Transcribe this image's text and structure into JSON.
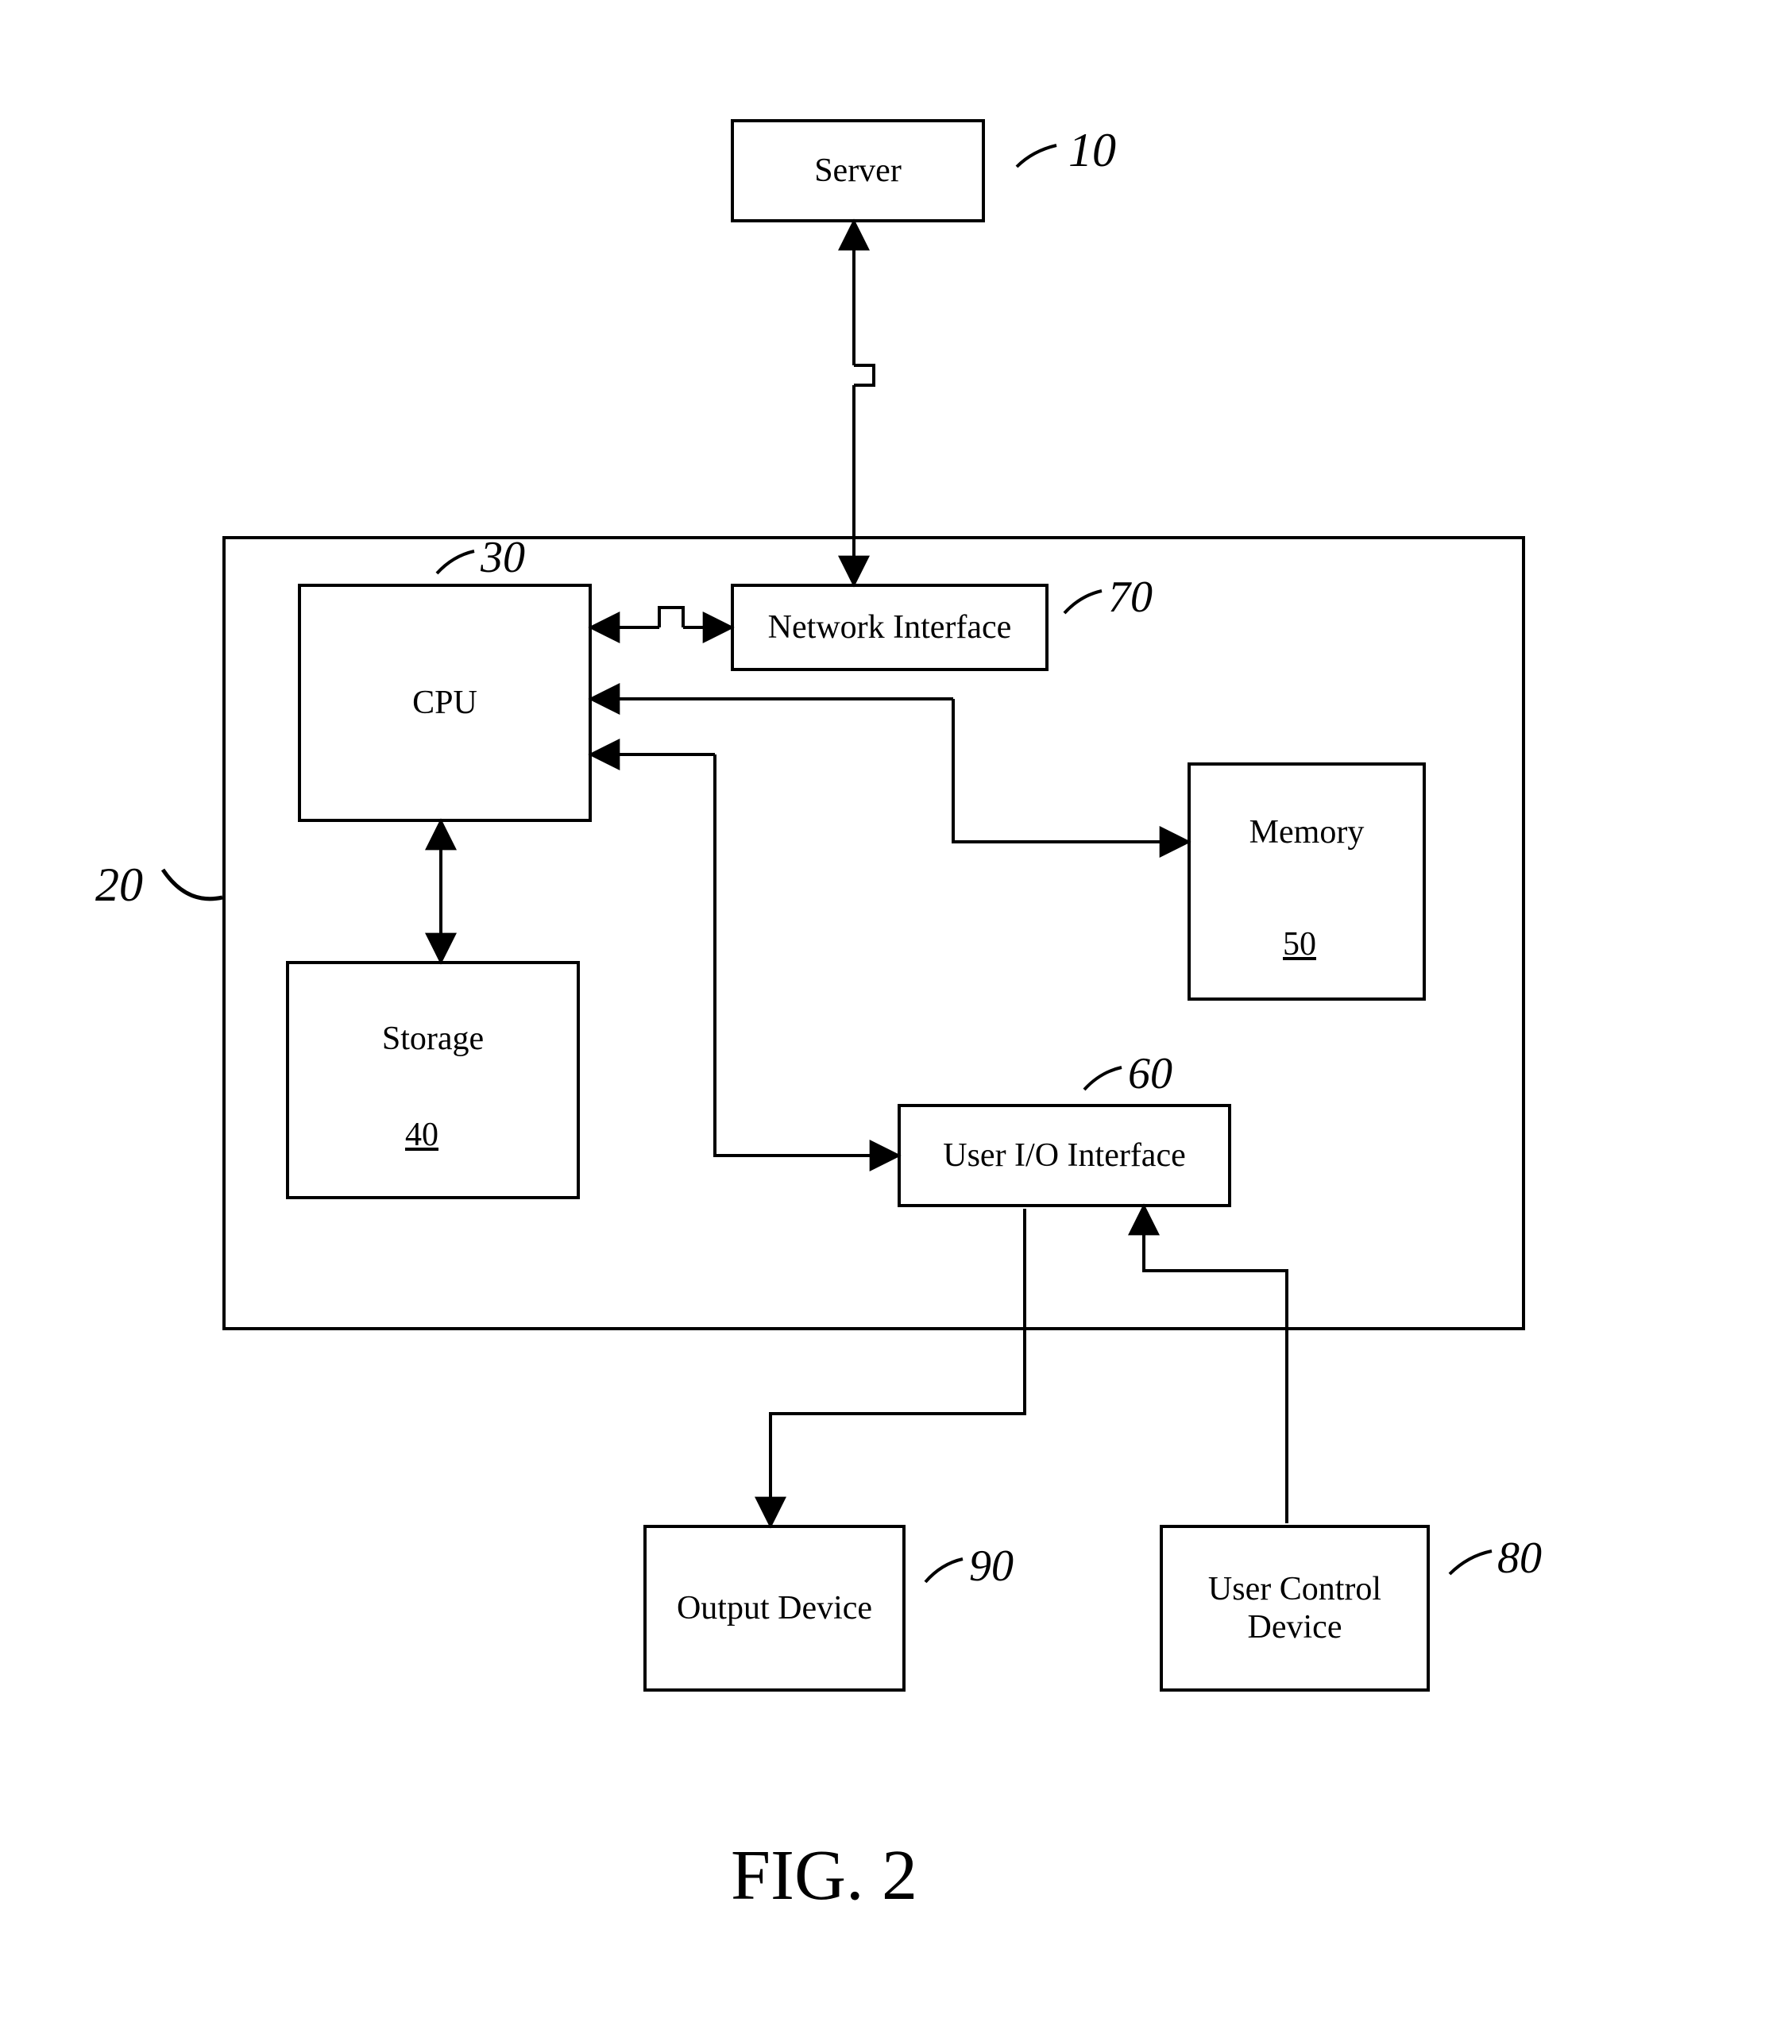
{
  "figure_label": "FIG. 2",
  "blocks": {
    "server": {
      "label": "Server",
      "ref": "10"
    },
    "container": {
      "ref": "20"
    },
    "cpu": {
      "label": "CPU",
      "ref": "30"
    },
    "storage": {
      "label": "Storage",
      "ref": "40"
    },
    "memory": {
      "label": "Memory",
      "ref": "50"
    },
    "userio": {
      "label": "User I/O Interface",
      "ref": "60"
    },
    "netif": {
      "label": "Network Interface",
      "ref": "70"
    },
    "usercontrol": {
      "label": "User Control Device",
      "ref": "80"
    },
    "output": {
      "label": "Output Device",
      "ref": "90"
    }
  },
  "chart_data": {
    "type": "block-diagram",
    "title": "FIG. 2",
    "nodes": [
      {
        "id": "server",
        "label": "Server",
        "ref": "10"
      },
      {
        "id": "container",
        "label": "",
        "ref": "20"
      },
      {
        "id": "cpu",
        "label": "CPU",
        "ref": "30"
      },
      {
        "id": "storage",
        "label": "Storage",
        "ref": "40"
      },
      {
        "id": "memory",
        "label": "Memory",
        "ref": "50"
      },
      {
        "id": "userio",
        "label": "User I/O Interface",
        "ref": "60"
      },
      {
        "id": "netif",
        "label": "Network Interface",
        "ref": "70"
      },
      {
        "id": "usercontrol",
        "label": "User Control Device",
        "ref": "80"
      },
      {
        "id": "output",
        "label": "Output Device",
        "ref": "90"
      }
    ],
    "edges": [
      {
        "from": "server",
        "to": "netif",
        "bidir": true
      },
      {
        "from": "cpu",
        "to": "netif",
        "bidir": true
      },
      {
        "from": "cpu",
        "to": "storage",
        "bidir": true
      },
      {
        "from": "cpu",
        "to": "memory",
        "bidir": false,
        "note": "CPU→Memory (via right-going path)"
      },
      {
        "from": "memory",
        "to": "cpu",
        "bidir": false,
        "note": "Memory→CPU (separate return arrow)"
      },
      {
        "from": "cpu",
        "to": "userio",
        "bidir": false
      },
      {
        "from": "userio",
        "to": "output",
        "bidir": false
      },
      {
        "from": "usercontrol",
        "to": "userio",
        "bidir": false
      }
    ]
  }
}
